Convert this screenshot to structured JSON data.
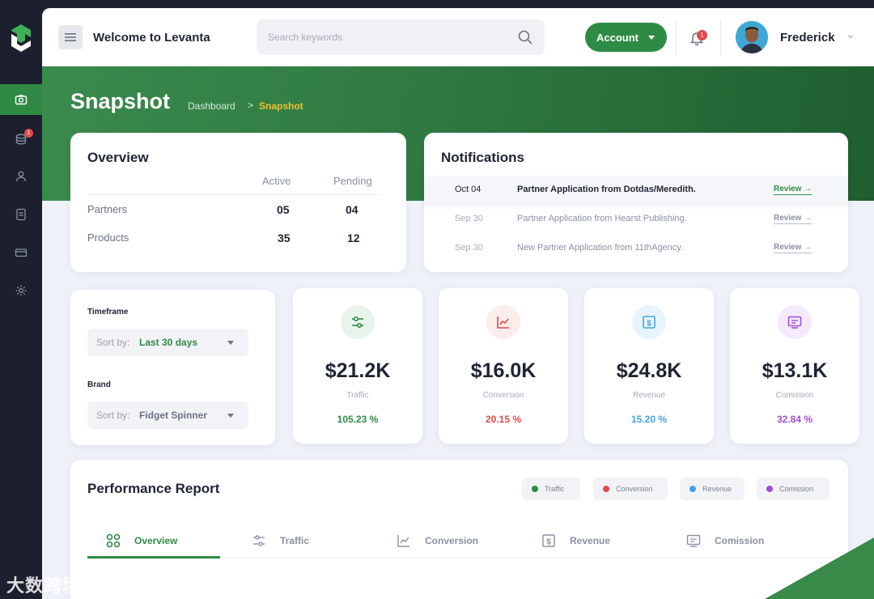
{
  "header": {
    "welcome": "Welcome to Levanta",
    "search_placeholder": "Search keywords",
    "account_label": "Account",
    "notification_count": "1",
    "user_name": "Frederick"
  },
  "sidebar": {
    "items": [
      {
        "icon": "camera-icon",
        "active": true
      },
      {
        "icon": "stack-icon",
        "badge": "1"
      },
      {
        "icon": "users-icon"
      },
      {
        "icon": "document-icon"
      },
      {
        "icon": "card-icon"
      },
      {
        "icon": "gear-icon"
      }
    ]
  },
  "page": {
    "title": "Snapshot",
    "breadcrumb": [
      "Dashboard",
      ">",
      "Snapshot"
    ]
  },
  "overview": {
    "title": "Overview",
    "columns": [
      "Active",
      "Pending"
    ],
    "rows": [
      {
        "label": "Partners",
        "active": "05",
        "pending": "04"
      },
      {
        "label": "Products",
        "active": "35",
        "pending": "12"
      }
    ]
  },
  "notifications": {
    "title": "Notifications",
    "items": [
      {
        "date": "Oct 04",
        "text": "Partner Application from Dotdas/Meredith.",
        "action": "Review"
      },
      {
        "date": "Sep 30",
        "text": "Partner Application from Hearst Publishing.",
        "action": "Review"
      },
      {
        "date": "Sep 30",
        "text": "New Partner Application from 11thAgency.",
        "action": "Review"
      }
    ]
  },
  "filters": {
    "timeframe_label": "Timeframe",
    "timeframe_prefix": "Sort by:",
    "timeframe_value": "Last 30 days",
    "brand_label": "Brand",
    "brand_prefix": "Sort by:",
    "brand_value": "Fidget Spinner"
  },
  "stats": [
    {
      "value": "$21.2K",
      "label": "Traffic",
      "percent": "105.23 %",
      "color": "#2e8b45",
      "icon": "sliders-icon"
    },
    {
      "value": "$16.0K",
      "label": "Conversion",
      "percent": "20.15 %",
      "color": "#e5484d",
      "icon": "chart-line-icon"
    },
    {
      "value": "$24.8K",
      "label": "Revenue",
      "percent": "15.20 %",
      "color": "#3ea5e6",
      "icon": "dollar-icon"
    },
    {
      "value": "$13.1K",
      "label": "Comission",
      "percent": "32.84 %",
      "color": "#a04ed6",
      "icon": "monitor-icon"
    }
  ],
  "performance": {
    "title": "Performance Report",
    "legend": [
      {
        "label": "Traffic",
        "color": "#2e8b45"
      },
      {
        "label": "Conversion",
        "color": "#e5484d"
      },
      {
        "label": "Revenue",
        "color": "#3ea5e6"
      },
      {
        "label": "Comission",
        "color": "#a04ed6"
      }
    ],
    "tabs": [
      "Overview",
      "Traffic",
      "Conversion",
      "Revenue",
      "Comission"
    ],
    "active_tab": "Overview"
  },
  "watermark": "大数跨境"
}
